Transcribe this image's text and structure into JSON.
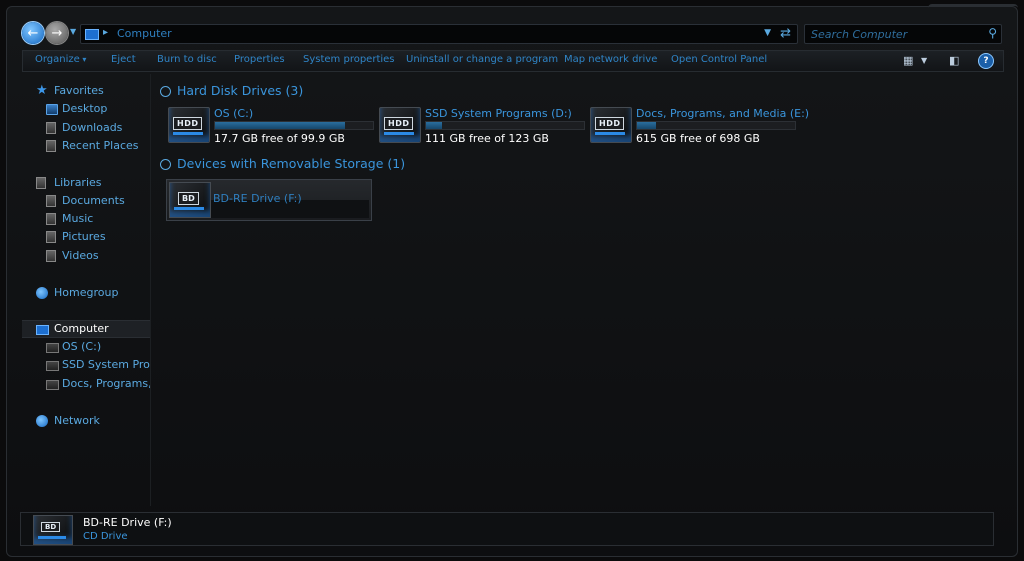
{
  "address_bar": {
    "crumb": "Computer",
    "search_placeholder": "Search Computer"
  },
  "commands": [
    "Organize",
    "Eject",
    "Burn to disc",
    "Properties",
    "System properties",
    "Uninstall or change a program",
    "Map network drive",
    "Open Control Panel"
  ],
  "sidebar": {
    "favorites": "Favorites",
    "desktop": "Desktop",
    "downloads": "Downloads",
    "recent": "Recent Places",
    "libraries": "Libraries",
    "documents": "Documents",
    "music": "Music",
    "pictures": "Pictures",
    "videos": "Videos",
    "homegroup": "Homegroup",
    "computer": "Computer",
    "drive_c": "OS (C:)",
    "drive_d": "SSD System Programs (D:)",
    "drive_e": "Docs, Programs, and Media (E:)",
    "network": "Network"
  },
  "groups": {
    "hard_disks": "Hard Disk Drives (3)",
    "removable": "Devices with Removable Storage (1)"
  },
  "drives": [
    {
      "name": "OS (C:)",
      "tag": "HDD",
      "free": "17.7 GB free of 99.9 GB",
      "used_fraction": 0.82
    },
    {
      "name": "SSD System Programs (D:)",
      "tag": "HDD",
      "free": "111 GB free of 123 GB",
      "used_fraction": 0.1
    },
    {
      "name": "Docs, Programs, and Media (E:)",
      "tag": "HDD",
      "free": "615 GB free of 698 GB",
      "used_fraction": 0.12
    }
  ],
  "removable": {
    "name": "BD-RE Drive (F:)",
    "tag": "BD"
  },
  "details": {
    "name": "BD-RE Drive (F:)",
    "type": "CD Drive",
    "tag": "BD"
  },
  "colors": {
    "accent": "#3a95dc",
    "background": "#0b0b0c",
    "bar_fill": "#2a6e9e"
  }
}
